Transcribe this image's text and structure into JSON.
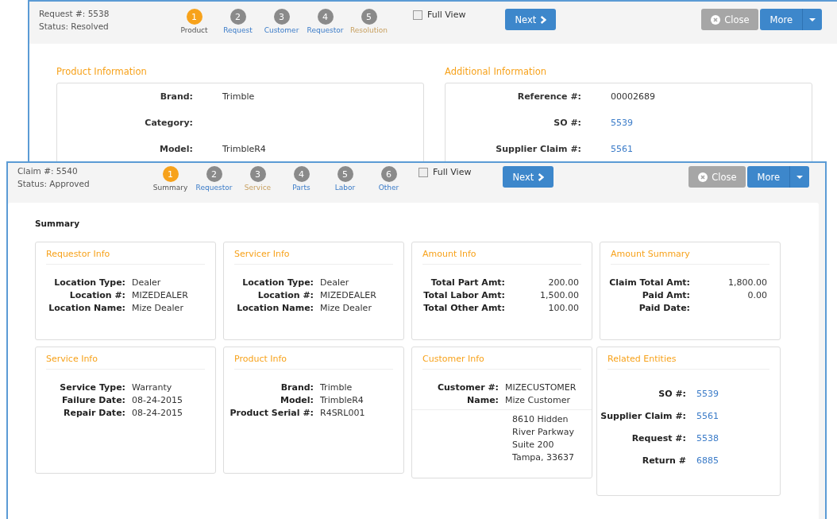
{
  "back_window": {
    "header": {
      "record": "Request #: 5538",
      "status": "Status: Resolved"
    },
    "steps": [
      {
        "number": "1",
        "label": "Product",
        "selected": true,
        "kind": "current"
      },
      {
        "number": "2",
        "label": "Request",
        "selected": false,
        "kind": "link"
      },
      {
        "number": "3",
        "label": "Customer",
        "selected": false,
        "kind": "link"
      },
      {
        "number": "4",
        "label": "Requestor",
        "selected": false,
        "kind": "link"
      },
      {
        "number": "5",
        "label": "Resolution",
        "selected": false,
        "kind": "pending"
      }
    ],
    "full_view": {
      "label": "Full View",
      "checked": false
    },
    "next_button": "Next",
    "close_button": "Close",
    "more_button": "More",
    "sections": [
      {
        "title": "Product Information",
        "fields": [
          {
            "label": "Brand:",
            "value": "Trimble",
            "kind": "text"
          },
          {
            "label": "Category:"
          },
          {
            "label": "Model:",
            "value": "TrimbleR4",
            "kind": "text"
          }
        ]
      },
      {
        "title": "Additional Information",
        "fields": [
          {
            "label": "Reference #:",
            "value": "00002689",
            "kind": "text"
          },
          {
            "label": "SO #:",
            "value": "5539",
            "kind": "link"
          },
          {
            "label": "Supplier Claim #:",
            "value": "5561",
            "kind": "link"
          }
        ]
      }
    ]
  },
  "front_window": {
    "header": {
      "record": "Claim #: 5540",
      "status": "Status: Approved"
    },
    "steps": [
      {
        "number": "1",
        "label": "Summary",
        "selected": true,
        "kind": "current"
      },
      {
        "number": "2",
        "label": "Requestor",
        "selected": false,
        "kind": "link"
      },
      {
        "number": "3",
        "label": "Service",
        "selected": false,
        "kind": "pending"
      },
      {
        "number": "4",
        "label": "Parts",
        "selected": false,
        "kind": "link"
      },
      {
        "number": "5",
        "label": "Labor",
        "selected": false,
        "kind": "link"
      },
      {
        "number": "6",
        "label": "Other",
        "selected": false,
        "kind": "link"
      }
    ],
    "full_view": {
      "label": "Full View",
      "checked": false
    },
    "next_button": "Next",
    "close_button": "Close",
    "more_button": "More",
    "summary_title": "Summary",
    "cards": [
      {
        "title": "Requestor Info",
        "kind": "details",
        "fields": [
          {
            "label": "Location Type:",
            "value": "Dealer"
          },
          {
            "label": "Location #:",
            "value": "MIZEDEALER"
          },
          {
            "label": "Location Name:",
            "value": "Mize Dealer"
          }
        ]
      },
      {
        "title": "Servicer Info",
        "kind": "details",
        "fields": [
          {
            "label": "Location Type:",
            "value": "Dealer"
          },
          {
            "label": "Location #:",
            "value": "MIZEDEALER"
          },
          {
            "label": "Location Name:",
            "value": "Mize Dealer"
          }
        ]
      },
      {
        "title": "Amount Info",
        "kind": "amounts",
        "fields": [
          {
            "label": "Total Part Amt:",
            "value": "200.00"
          },
          {
            "label": "Total Labor Amt:",
            "value": "1,500.00"
          },
          {
            "label": "Total Other Amt:",
            "value": "100.00"
          }
        ]
      },
      {
        "title": "Amount Summary",
        "kind": "amounts",
        "fields": [
          {
            "label": "Claim Total Amt:",
            "value": "1,800.00"
          },
          {
            "label": "Paid Amt:",
            "value": "0.00"
          },
          {
            "label": "Paid Date:"
          }
        ]
      },
      {
        "title": "Service Info",
        "kind": "details",
        "fields": [
          {
            "label": "Service Type:",
            "value": "Warranty"
          },
          {
            "label": "Failure Date:",
            "value": "08-24-2015"
          },
          {
            "label": "Repair Date:",
            "value": "08-24-2015"
          }
        ]
      },
      {
        "title": "Product Info",
        "kind": "details",
        "fields": [
          {
            "label": "Brand:",
            "value": "Trimble"
          },
          {
            "label": "Model:",
            "value": "TrimbleR4"
          },
          {
            "label": "Product Serial #:",
            "value": "R4SRL001"
          }
        ]
      },
      {
        "title": "Customer Info",
        "kind": "details",
        "fields": [
          {
            "label": "Customer #:",
            "value": "MIZECUSTOMER"
          },
          {
            "label": "Name:",
            "value": "Mize Customer"
          }
        ],
        "address": [
          "8610 Hidden",
          "River Parkway",
          "Suite 200",
          "Tampa, 33637"
        ]
      },
      {
        "title": "Related Entities",
        "kind": "links",
        "fields": [
          {
            "label": "SO #:",
            "value": "5539"
          },
          {
            "label": "Supplier Claim #:",
            "value": "5561"
          },
          {
            "label": "Request #:",
            "value": "5538"
          },
          {
            "label": "Return #",
            "value": "6885"
          }
        ]
      }
    ]
  }
}
